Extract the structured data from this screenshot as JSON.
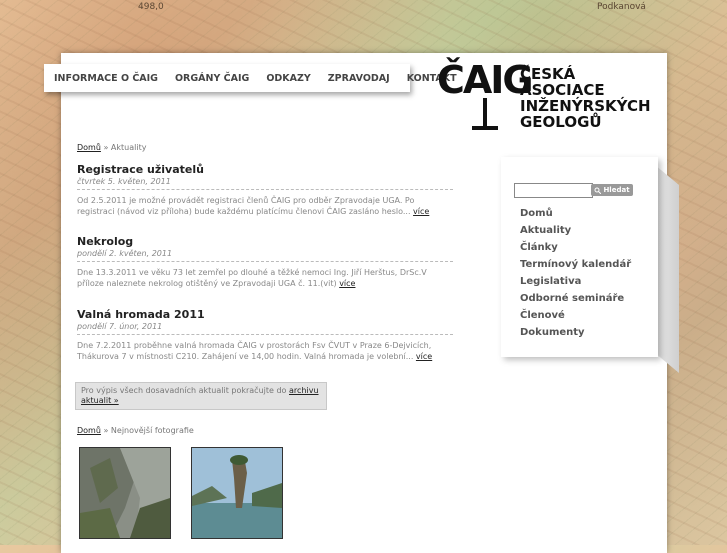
{
  "map_labels": [
    "498,0",
    "Podkanová"
  ],
  "nav": {
    "items": [
      "INFORMACE O ČAIG",
      "ORGÁNY ČAIG",
      "ODKAZY",
      "ZPRAVODAJ",
      "KONTAKT"
    ]
  },
  "logo": {
    "mark": "ČAIG",
    "lines": [
      "ČESKÁ",
      "ASOCIACE",
      "INŽENÝRSKÝCH",
      "GEOLOGŮ"
    ]
  },
  "breadcrumb1": {
    "home": "Domů",
    "separator": "»",
    "current": "Aktuality"
  },
  "articles": [
    {
      "title": "Registrace uživatelů",
      "date": "čtvrtek 5. květen, 2011",
      "text": "Od 2.5.2011 je možné provádět registraci členů ČAIG pro odběr Zpravodaje UGA. Po registraci (návod viz příloha) bude každému platícímu členovi ČAIG zasláno heslo...",
      "more": "více"
    },
    {
      "title": "Nekrolog",
      "date": "pondělí 2. květen, 2011",
      "text": "Dne 13.3.2011 ve věku 73 let zemřel po dlouhé a těžké nemoci Ing. Jiří Herštus, DrSc.V příloze naleznete nekrolog otištěný ve Zpravodaji UGA č. 11.(vit)",
      "more": "více"
    },
    {
      "title": "Valná hromada 2011",
      "date": "pondělí 7. únor, 2011",
      "text": "Dne 7.2.2011 proběhne valná hromada ČAIG v prostorách Fsv ČVUT v Praze 6-Dejvicích, Thákurova 7 v místnosti C210. Zahájení ve 14,00 hodin. Valná hromada je volební...",
      "more": "více"
    }
  ],
  "archive": {
    "text": "Pro výpis všech dosavadních aktualit pokračujte do",
    "link": "archivu aktualit »"
  },
  "breadcrumb2": {
    "home": "Domů",
    "separator": "»",
    "current": "Nejnovější fotografie"
  },
  "sidebar": {
    "search_placeholder": "",
    "search_button": "Hledat",
    "menu": [
      "Domů",
      "Aktuality",
      "Články",
      "Termínový kalendář",
      "Legislativa",
      "Odborné semináře",
      "Členové",
      "Dokumenty"
    ]
  },
  "colors": {
    "accent": "#222222",
    "muted": "#888888",
    "menu": "#555555"
  }
}
